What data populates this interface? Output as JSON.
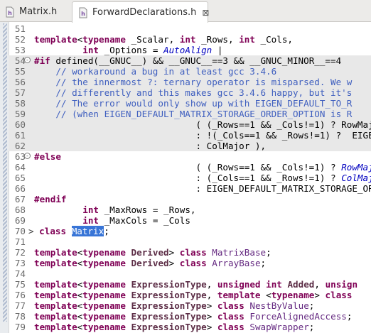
{
  "tabs": [
    {
      "label": "Matrix.h",
      "active": false,
      "icon": "header-file-icon"
    },
    {
      "label": "ForwardDeclarations.h",
      "active": true,
      "icon": "header-file-icon",
      "close": "⊠"
    }
  ],
  "colors": {
    "keyword": "#7f0055",
    "comment": "#3f5fbf",
    "macro": "#0000c0",
    "selection": "#3875d7",
    "inactive_highlight": "#e8e8e8"
  },
  "lines": [
    {
      "n": "51",
      "hl": false,
      "fold": "",
      "segs": []
    },
    {
      "n": "52",
      "hl": false,
      "fold": "",
      "segs": [
        {
          "c": "kw",
          "t": "template"
        },
        {
          "c": "",
          "t": "<"
        },
        {
          "c": "kw",
          "t": "typename"
        },
        {
          "c": "",
          "t": " _Scalar, "
        },
        {
          "c": "kw",
          "t": "int"
        },
        {
          "c": "",
          "t": " _Rows, "
        },
        {
          "c": "kw",
          "t": "int"
        },
        {
          "c": "",
          "t": " _Cols,"
        }
      ]
    },
    {
      "n": "53",
      "hl": false,
      "fold": "",
      "segs": [
        {
          "c": "",
          "t": "         "
        },
        {
          "c": "kw",
          "t": "int"
        },
        {
          "c": "",
          "t": " _Options = "
        },
        {
          "c": "it",
          "t": "AutoAlign"
        },
        {
          "c": "",
          "t": " |"
        }
      ]
    },
    {
      "n": "54",
      "hl": true,
      "fold": "-",
      "segs": [
        {
          "c": "kw",
          "t": "#if"
        },
        {
          "c": "",
          "t": " defined(__GNUC__) && __GNUC__==3 && __GNUC_MINOR__==4"
        }
      ]
    },
    {
      "n": "55",
      "hl": true,
      "fold": "",
      "segs": [
        {
          "c": "cm",
          "t": "    // workaround a bug in at least gcc 3.4.6"
        }
      ]
    },
    {
      "n": "56",
      "hl": true,
      "fold": "",
      "segs": [
        {
          "c": "cm",
          "t": "    // the innermost ?: ternary operator is misparsed. We w"
        }
      ]
    },
    {
      "n": "57",
      "hl": true,
      "fold": "",
      "segs": [
        {
          "c": "cm",
          "t": "    // differently and this makes gcc 3.4.6 happy, but it's"
        }
      ]
    },
    {
      "n": "58",
      "hl": true,
      "fold": "",
      "segs": [
        {
          "c": "cm",
          "t": "    // The error would only show up with EIGEN_DEFAULT_TO_R"
        }
      ]
    },
    {
      "n": "59",
      "hl": true,
      "fold": "",
      "segs": [
        {
          "c": "cm",
          "t": "    // (when EIGEN_DEFAULT_MATRIX_STORAGE_ORDER_OPTION is R"
        }
      ]
    },
    {
      "n": "60",
      "hl": true,
      "fold": "",
      "segs": [
        {
          "c": "",
          "t": "                              ( (_Rows==1 && _Cols!=1) ? RowMaj"
        }
      ]
    },
    {
      "n": "61",
      "hl": true,
      "fold": "",
      "segs": [
        {
          "c": "",
          "t": "                              : !(_Cols==1 && _Rows!=1) ?  EIGE"
        }
      ]
    },
    {
      "n": "62",
      "hl": true,
      "fold": "",
      "segs": [
        {
          "c": "",
          "t": "                              : ColMajor ),"
        }
      ]
    },
    {
      "n": "63",
      "hl": false,
      "fold": "-",
      "segs": [
        {
          "c": "kw",
          "t": "#else"
        }
      ]
    },
    {
      "n": "64",
      "hl": false,
      "fold": "",
      "segs": [
        {
          "c": "",
          "t": "                              ( (_Rows==1 && _Cols!=1) ? "
        },
        {
          "c": "it",
          "t": "RowMajo"
        }
      ]
    },
    {
      "n": "65",
      "hl": false,
      "fold": "",
      "segs": [
        {
          "c": "",
          "t": "                              : (_Cols==1 && _Rows!=1) ? "
        },
        {
          "c": "it",
          "t": "ColMajo"
        }
      ]
    },
    {
      "n": "66",
      "hl": false,
      "fold": "",
      "segs": [
        {
          "c": "",
          "t": "                              : EIGEN_DEFAULT_MATRIX_STORAGE_ORD"
        }
      ]
    },
    {
      "n": "67",
      "hl": false,
      "fold": "",
      "segs": [
        {
          "c": "kw",
          "t": "#endif"
        }
      ]
    },
    {
      "n": "68",
      "hl": false,
      "fold": "",
      "segs": [
        {
          "c": "",
          "t": "         "
        },
        {
          "c": "kw",
          "t": "int"
        },
        {
          "c": "",
          "t": " _MaxRows = _Rows,"
        }
      ]
    },
    {
      "n": "69",
      "hl": false,
      "fold": "",
      "segs": [
        {
          "c": "",
          "t": "         "
        },
        {
          "c": "kw",
          "t": "int"
        },
        {
          "c": "",
          "t": " _MaxCols = _Cols"
        }
      ]
    },
    {
      "n": "70",
      "hl": false,
      "fold": "",
      "prefix": "> ",
      "segs": [
        {
          "c": "kw",
          "t": "class"
        },
        {
          "c": "",
          "t": " "
        },
        {
          "c": "sel",
          "t": "Matrix"
        },
        {
          "c": "",
          "t": ";"
        }
      ]
    },
    {
      "n": "71",
      "hl": false,
      "fold": "",
      "segs": []
    },
    {
      "n": "72",
      "hl": false,
      "fold": "",
      "segs": [
        {
          "c": "kw",
          "t": "template"
        },
        {
          "c": "",
          "t": "<"
        },
        {
          "c": "kw",
          "t": "typename"
        },
        {
          "c": "",
          "t": " "
        },
        {
          "c": "tp",
          "t": "Derived"
        },
        {
          "c": "",
          "t": "> "
        },
        {
          "c": "kw",
          "t": "class"
        },
        {
          "c": "",
          "t": " "
        },
        {
          "c": "tn",
          "t": "MatrixBase"
        },
        {
          "c": "",
          "t": ";"
        }
      ]
    },
    {
      "n": "73",
      "hl": false,
      "fold": "",
      "segs": [
        {
          "c": "kw",
          "t": "template"
        },
        {
          "c": "",
          "t": "<"
        },
        {
          "c": "kw",
          "t": "typename"
        },
        {
          "c": "",
          "t": " "
        },
        {
          "c": "tp",
          "t": "Derived"
        },
        {
          "c": "",
          "t": "> "
        },
        {
          "c": "kw",
          "t": "class"
        },
        {
          "c": "",
          "t": " "
        },
        {
          "c": "tn",
          "t": "ArrayBase"
        },
        {
          "c": "",
          "t": ";"
        }
      ]
    },
    {
      "n": "74",
      "hl": false,
      "fold": "",
      "segs": []
    },
    {
      "n": "75",
      "hl": false,
      "fold": "",
      "segs": [
        {
          "c": "kw",
          "t": "template"
        },
        {
          "c": "",
          "t": "<"
        },
        {
          "c": "kw",
          "t": "typename"
        },
        {
          "c": "",
          "t": " "
        },
        {
          "c": "tp",
          "t": "ExpressionType"
        },
        {
          "c": "",
          "t": ", "
        },
        {
          "c": "kw",
          "t": "unsigned"
        },
        {
          "c": "",
          "t": " "
        },
        {
          "c": "kw",
          "t": "int"
        },
        {
          "c": "",
          "t": " "
        },
        {
          "c": "tp",
          "t": "Added"
        },
        {
          "c": "",
          "t": ", "
        },
        {
          "c": "kw",
          "t": "unsign"
        }
      ]
    },
    {
      "n": "76",
      "hl": false,
      "fold": "",
      "segs": [
        {
          "c": "kw",
          "t": "template"
        },
        {
          "c": "",
          "t": "<"
        },
        {
          "c": "kw",
          "t": "typename"
        },
        {
          "c": "",
          "t": " "
        },
        {
          "c": "tp",
          "t": "ExpressionType"
        },
        {
          "c": "",
          "t": ", "
        },
        {
          "c": "kw",
          "t": "template"
        },
        {
          "c": "",
          "t": " <"
        },
        {
          "c": "kw",
          "t": "typename"
        },
        {
          "c": "",
          "t": "> "
        },
        {
          "c": "kw",
          "t": "class"
        }
      ]
    },
    {
      "n": "77",
      "hl": false,
      "fold": "",
      "segs": [
        {
          "c": "kw",
          "t": "template"
        },
        {
          "c": "",
          "t": "<"
        },
        {
          "c": "kw",
          "t": "typename"
        },
        {
          "c": "",
          "t": " "
        },
        {
          "c": "tp",
          "t": "ExpressionType"
        },
        {
          "c": "",
          "t": "> "
        },
        {
          "c": "kw",
          "t": "class"
        },
        {
          "c": "",
          "t": " "
        },
        {
          "c": "tn",
          "t": "NestByValue"
        },
        {
          "c": "",
          "t": ";"
        }
      ]
    },
    {
      "n": "78",
      "hl": false,
      "fold": "",
      "segs": [
        {
          "c": "kw",
          "t": "template"
        },
        {
          "c": "",
          "t": "<"
        },
        {
          "c": "kw",
          "t": "typename"
        },
        {
          "c": "",
          "t": " "
        },
        {
          "c": "tp",
          "t": "ExpressionType"
        },
        {
          "c": "",
          "t": "> "
        },
        {
          "c": "kw",
          "t": "class"
        },
        {
          "c": "",
          "t": " "
        },
        {
          "c": "tn",
          "t": "ForceAlignedAccess"
        },
        {
          "c": "",
          "t": ";"
        }
      ]
    },
    {
      "n": "79",
      "hl": false,
      "fold": "",
      "segs": [
        {
          "c": "kw",
          "t": "template"
        },
        {
          "c": "",
          "t": "<"
        },
        {
          "c": "kw",
          "t": "typename"
        },
        {
          "c": "",
          "t": " "
        },
        {
          "c": "tp",
          "t": "ExpressionType"
        },
        {
          "c": "",
          "t": "> "
        },
        {
          "c": "kw",
          "t": "class"
        },
        {
          "c": "",
          "t": " "
        },
        {
          "c": "tn",
          "t": "SwapWrapper"
        },
        {
          "c": "",
          "t": ";"
        }
      ]
    }
  ]
}
